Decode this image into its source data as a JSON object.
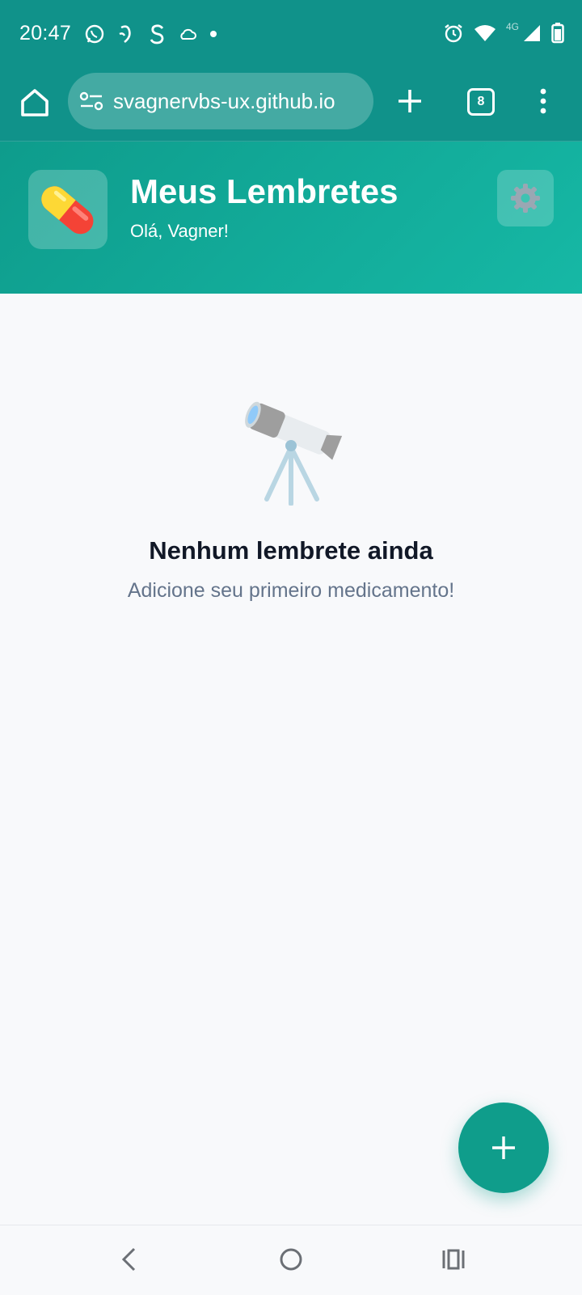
{
  "status_bar": {
    "time": "20:47",
    "network_label": "4G",
    "left_icons": [
      "whatsapp-icon",
      "app-notification-icon",
      "s-app-icon",
      "cloud-icon",
      "dot-icon"
    ],
    "right_icons": [
      "alarm-icon",
      "wifi-icon",
      "signal-icon",
      "battery-icon"
    ]
  },
  "browser": {
    "url": "svagnervbs-ux.github.io",
    "tab_count": "8",
    "icons": [
      "home-icon",
      "site-settings-icon",
      "new-tab-icon",
      "tabs-icon",
      "more-menu-icon"
    ]
  },
  "header": {
    "title": "Meus Lembretes",
    "greeting": "Olá, Vagner!",
    "logo_icon": "pill-icon",
    "settings_icon": "gear-icon"
  },
  "empty_state": {
    "icon": "telescope-icon",
    "title": "Nenhum lembrete ainda",
    "subtitle": "Adicione seu primeiro medicamento!"
  },
  "fab": {
    "icon": "plus-icon"
  },
  "navigation": {
    "icons": [
      "back-icon",
      "home-circle-icon",
      "recents-icon"
    ]
  },
  "colors": {
    "primary": "#10928a",
    "header_gradient_start": "#0e9c8c",
    "header_gradient_end": "#16b8a5",
    "fab": "#0f9d8b",
    "background": "#f8f9fb",
    "title_text": "#111827",
    "subtitle_text": "#64748b"
  }
}
